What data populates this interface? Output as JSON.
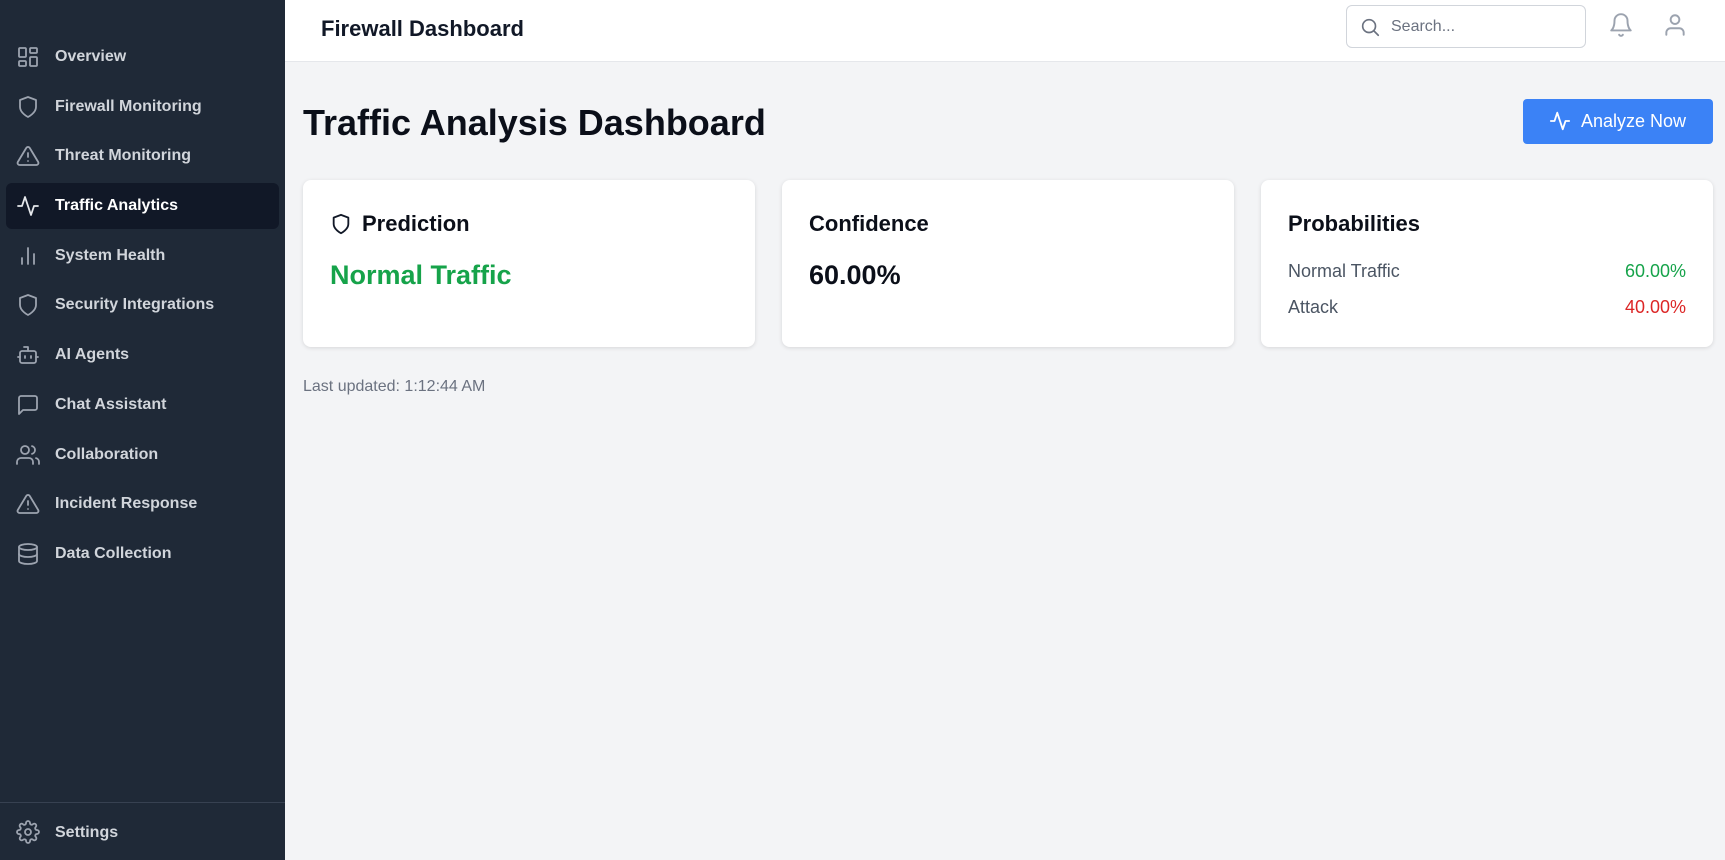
{
  "sidebar": {
    "items": [
      {
        "label": "Overview",
        "icon": "layout-grid-icon"
      },
      {
        "label": "Firewall Monitoring",
        "icon": "shield-icon"
      },
      {
        "label": "Threat Monitoring",
        "icon": "alert-triangle-icon"
      },
      {
        "label": "Traffic Analytics",
        "icon": "activity-icon",
        "active": true
      },
      {
        "label": "System Health",
        "icon": "bar-chart-icon"
      },
      {
        "label": "Security Integrations",
        "icon": "shield-icon"
      },
      {
        "label": "AI Agents",
        "icon": "bot-icon"
      },
      {
        "label": "Chat Assistant",
        "icon": "message-square-icon"
      },
      {
        "label": "Collaboration",
        "icon": "users-icon"
      },
      {
        "label": "Incident Response",
        "icon": "alert-triangle-icon"
      },
      {
        "label": "Data Collection",
        "icon": "database-icon"
      }
    ],
    "settings": {
      "label": "Settings",
      "icon": "gear-icon"
    }
  },
  "header": {
    "title": "Firewall Dashboard",
    "search_placeholder": "Search...",
    "icons": [
      "bell-icon",
      "user-icon"
    ]
  },
  "main": {
    "title": "Traffic Analysis Dashboard",
    "analyze_button": {
      "label": "Analyze Now",
      "icon": "activity-icon"
    },
    "prediction": {
      "title": "Prediction",
      "value": "Normal Traffic",
      "icon": "shield-icon"
    },
    "confidence": {
      "title": "Confidence",
      "value": "60.00%"
    },
    "probabilities": {
      "title": "Probabilities",
      "rows": [
        {
          "label": "Normal Traffic",
          "value": "60.00%"
        },
        {
          "label": "Attack",
          "value": "40.00%"
        }
      ]
    },
    "last_updated_label": "Last updated:",
    "last_updated_time": "1:12:44 AM"
  },
  "colors": {
    "sidebar_bg": "#1f2937",
    "active_bg": "#111827",
    "accent": "#3b82f6",
    "positive": "#16a34a",
    "negative": "#dc2626"
  }
}
